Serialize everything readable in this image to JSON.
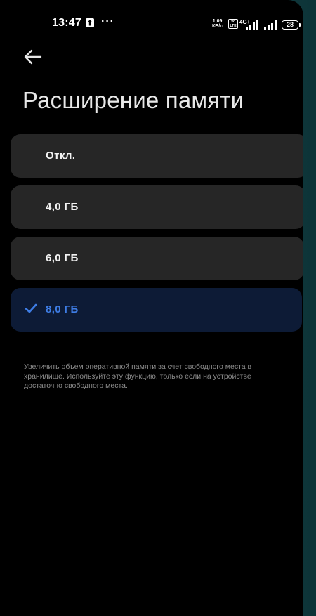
{
  "status_bar": {
    "time": "13:47",
    "notification_dots": "···",
    "net_speed_value": "1,09",
    "net_speed_unit": "КБ/с",
    "volte_label": "Vo LTE",
    "network_type": "4G+",
    "battery_level": "28"
  },
  "header": {
    "title": "Расширение памяти"
  },
  "options": [
    {
      "label": "Откл.",
      "selected": false
    },
    {
      "label": "4,0 ГБ",
      "selected": false
    },
    {
      "label": "6,0 ГБ",
      "selected": false
    },
    {
      "label": "8,0 ГБ",
      "selected": true
    }
  ],
  "description": "Увеличить объем оперативной памяти за счет свободного места в хранилище. Используйте эту функцию, только если на устройстве достаточно свободного места.",
  "colors": {
    "background": "#000000",
    "card": "#262626",
    "selected_card": "#0d1b36",
    "accent": "#3e7de5",
    "frame": "#124045"
  },
  "icons": {
    "back": "arrow-left-icon",
    "check": "checkmark-icon",
    "upload": "upload-arrow-icon",
    "signal": "signal-bars-icon",
    "battery": "battery-icon"
  }
}
